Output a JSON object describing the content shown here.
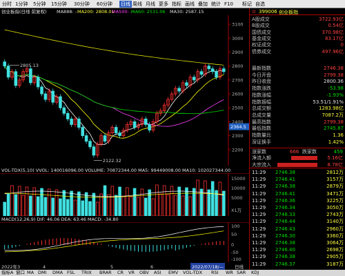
{
  "toolbar": {
    "items": [
      "分时",
      "1分钟",
      "5分钟",
      "15分钟",
      "30分钟",
      "60分钟",
      "日线",
      "周线",
      "月线",
      "更多",
      "指标",
      "画线",
      "叠加",
      "统计",
      "F10",
      "标记",
      "自选"
    ],
    "active": "日线"
  },
  "chart": {
    "header": "创业板指(日线 前复权)",
    "ma_label": "MA888: -",
    "ma200": "MA200: 2808.01",
    "ma500": "MA500: -",
    "ma60": "MA60: 2531.06",
    "ma_tail": "MA30: 2587.15",
    "price_axis": [
      "3100",
      "3000",
      "2900",
      "2800",
      "2700",
      "2600",
      "2500",
      "2400",
      "2300",
      "2200"
    ],
    "high_label": "2805.13",
    "low_label": "2122.32",
    "cursor_price": "2364.5",
    "vol_header": "VOL-TDX(5,10) VVOL: 140016096.00 VOLUME: 70872344.00 MA5: 99449008.00 MA10: 102027344.00",
    "vol_axis": [
      "15000",
      "10000",
      "5000",
      "X1万"
    ],
    "macd_header": "MACD(12,26,9) DIF: 46.06 DEA: 63.46 MACD: -34.80",
    "macd_axis": [
      "100",
      "50",
      "0",
      "-50",
      "-100"
    ],
    "date_labels": [
      "2022年3",
      "4",
      "5",
      "6"
    ],
    "date_cursor": "2022/07/18/—",
    "period_label": "日线"
  },
  "chart_data": {
    "type": "candlestick",
    "title": "创业板指(日线 前复权)",
    "x_range": [
      "2022-03",
      "2022-07-18"
    ],
    "ylim": [
      2100,
      3150
    ],
    "close": [
      2800,
      2720,
      2760,
      2660,
      2700,
      2760,
      2780,
      2680,
      2720,
      2650,
      2600,
      2560,
      2620,
      2540,
      2580,
      2500,
      2460,
      2420,
      2380,
      2420,
      2360,
      2300,
      2260,
      2220,
      2160,
      2240,
      2300,
      2260,
      2320,
      2360,
      2320,
      2300,
      2340,
      2380,
      2400,
      2360,
      2380,
      2420,
      2380,
      2340,
      2400,
      2460,
      2480,
      2520,
      2560,
      2600,
      2640,
      2620,
      2680,
      2660,
      2720,
      2700,
      2760,
      2740,
      2800,
      2780,
      2760,
      2720,
      2780,
      2760
    ],
    "high_marker": 2805.13,
    "low_marker": 2122.32,
    "last_close": 2746.38,
    "series": [
      {
        "name": "MA200",
        "last": 2808.01
      },
      {
        "name": "MA60",
        "last": 2531.06
      },
      {
        "name": "MA30",
        "last": 2587.15
      }
    ]
  },
  "panel": {
    "code": "399006",
    "name": "创业板指",
    "market": [
      {
        "label": "A股成交",
        "value": "3722.93亿"
      },
      {
        "label": "B股成交",
        "value": "0.54亿"
      },
      {
        "label": "国债成交",
        "value": "370.98亿"
      },
      {
        "label": "基金成交",
        "value": "83.17亿"
      },
      {
        "label": "权证成交",
        "value": "0"
      },
      {
        "label": "债券成交",
        "value": "497.96亿"
      }
    ],
    "stats": [
      {
        "label": "最新指数",
        "value": "2746.38"
      },
      {
        "label": "今日开盘",
        "value": "2799.38"
      },
      {
        "label": "昨日收盘",
        "value": "2800.36"
      },
      {
        "label": "指数涨跌",
        "value": "-53.98"
      },
      {
        "label": "指数涨幅",
        "value": "-1.93%"
      },
      {
        "label": "指数振幅",
        "value": "53.51/1.91%"
      },
      {
        "label": "总成交额",
        "value": "1283.98亿"
      },
      {
        "label": "总成交量",
        "value": "7087.2万"
      },
      {
        "label": "最高指数",
        "value": "2799.38"
      },
      {
        "label": "最低指数",
        "value": "2745.87"
      },
      {
        "label": "指数量比",
        "value": "1.36"
      },
      {
        "label": "深证换手",
        "value": "1.42%"
      }
    ],
    "up_label": "涨家数",
    "up_count": "666",
    "down_label": "跌家数",
    "down_count": "459",
    "inflow_label": "净流入额",
    "inflow_value": "5.16亿",
    "big_label": "大宗流入",
    "big_value": "8.78亿",
    "ticks": [
      {
        "t": "11:29",
        "p": "2746.38",
        "v": "2812万"
      },
      {
        "t": "11:29",
        "p": "2746.41",
        "v": "3157万"
      },
      {
        "t": "11:29",
        "p": "2746.38",
        "v": "2879万"
      },
      {
        "t": "11:29",
        "p": "2746.41",
        "v": "3471万"
      },
      {
        "t": "11:29",
        "p": "2746.36",
        "v": "3225万"
      },
      {
        "t": "11:29",
        "p": "2746.34",
        "v": "3050万"
      },
      {
        "t": "11:29",
        "p": "2746.33",
        "v": "2743万"
      },
      {
        "t": "11:29",
        "p": "2746.44",
        "v": "3140万"
      },
      {
        "t": "11:29",
        "p": "2746.43",
        "v": "2960万"
      },
      {
        "t": "11:29",
        "p": "2746.30",
        "v": "3360万"
      },
      {
        "t": "11:29",
        "p": "2746.38",
        "v": "3064万"
      },
      {
        "t": "11:29",
        "p": "2746.40",
        "v": "2698万"
      },
      {
        "t": "11:29",
        "p": "2746.38",
        "v": "2905万"
      },
      {
        "t": "11:29",
        "p": "2746.37",
        "v": "3187万"
      }
    ]
  },
  "bottom_tabs": [
    "指标A",
    "窗口",
    "MA",
    "DMI",
    "DMA",
    "FSL",
    "TRIX",
    "BRAR",
    "CR",
    "VR",
    "OBV",
    "ASI",
    "EMV",
    "VOL-TDX",
    "RSI",
    "WR",
    "SAR",
    "KDJ"
  ],
  "colors": {
    "up": "#ff3030",
    "down": "#40e0e0",
    "ma1": "#ffffff",
    "ma2": "#ffff00",
    "ma3": "#ff40ff",
    "ma4": "#00e000",
    "bg": "#000000"
  }
}
